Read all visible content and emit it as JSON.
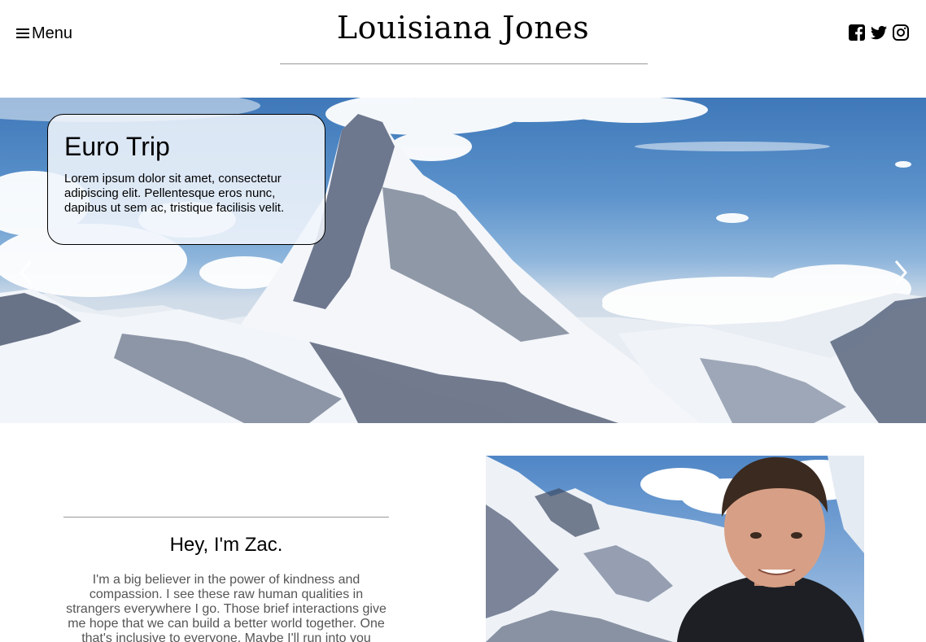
{
  "header": {
    "menu_label": "Menu",
    "site_title": "Louisiana Jones",
    "social": [
      "facebook-icon",
      "twitter-icon",
      "instagram-icon"
    ]
  },
  "hero": {
    "title": "Euro Trip",
    "text": "Lorem ipsum dolor sit amet, consectetur adipiscing elit. Pellentesque eros nunc, dapibus ut sem ac, tristique facilisis velit.",
    "prev_icon": "chevron-left-icon",
    "next_icon": "chevron-right-icon"
  },
  "about": {
    "heading": "Hey, I'm Zac.",
    "text": "I'm a big believer in the power of kindness and compassion. I see these raw human qualities in strangers everywhere I go. Those brief interactions give me hope that we can build a better world together. One that's inclusive to everyone. Maybe I'll run into you"
  },
  "colors": {
    "sky": "#5c93cc",
    "snow": "#f2f5f9",
    "rock": "#3d4a63",
    "rule": "#999999"
  }
}
